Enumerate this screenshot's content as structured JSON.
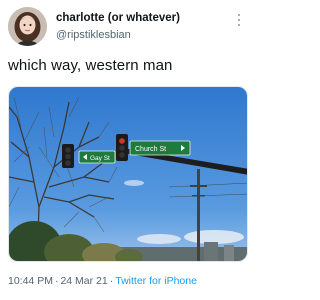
{
  "tweet": {
    "display_name": "charlotte (or whatever)",
    "handle": "@ripstiklesbian",
    "text": "which way, western man",
    "time": "10:44 PM",
    "separator": "·",
    "date": "24 Mar 21",
    "source": "Twitter for iPhone"
  },
  "photo": {
    "signs": {
      "left_sign": "Gay St",
      "right_sign": "Church St"
    },
    "colors": {
      "sky": "#3f86d6",
      "street_sign": "#1f7a3d",
      "signal_housing": "#1b1b1b"
    }
  },
  "icons": {
    "more": "more-vertical-icon",
    "left_arrow": "arrow-left-icon",
    "right_arrow": "arrow-right-icon"
  },
  "colors": {
    "text_primary": "#0f1419",
    "text_secondary": "#536471",
    "link": "#1d9bf0"
  }
}
